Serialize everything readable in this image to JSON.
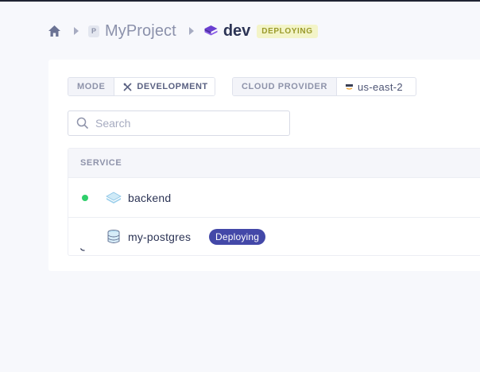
{
  "breadcrumb": {
    "project_badge": "P",
    "project_name": "MyProject",
    "environment_name": "dev",
    "environment_status": "DEPLOYING"
  },
  "environment": {
    "mode_label": "MODE",
    "mode_value": "DEVELOPMENT",
    "cloud_label": "CLOUD PROVIDER",
    "cloud_value": "us-east-2"
  },
  "search": {
    "placeholder": "Search",
    "value": ""
  },
  "table": {
    "header": "SERVICE",
    "rows": [
      {
        "name": "backend",
        "status": "running",
        "icon": "layers-icon",
        "badge": ""
      },
      {
        "name": "my-postgres",
        "status": "deploying",
        "icon": "database-icon",
        "badge": "Deploying"
      }
    ]
  },
  "colors": {
    "running": "#2fcf6b",
    "deploying_badge": "#4348a8",
    "env_status_bg": "#f3f4c8",
    "env_status_text": "#9a9a2a"
  }
}
